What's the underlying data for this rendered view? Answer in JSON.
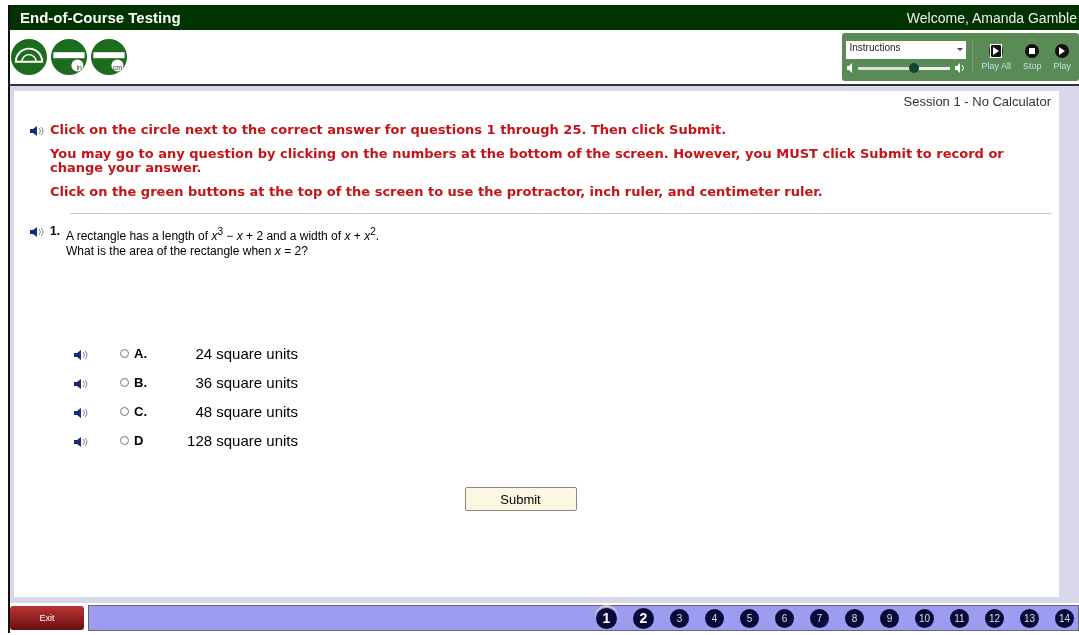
{
  "header": {
    "title": "End-of-Course Testing",
    "welcome": "Welcome, Amanda Gamble"
  },
  "tools": [
    {
      "kind": "protractor"
    },
    {
      "kind": "ruler",
      "unit": "in"
    },
    {
      "kind": "ruler",
      "unit": "cm"
    }
  ],
  "audio": {
    "dropdown": "Instructions",
    "level": 0.6,
    "buttons": [
      {
        "kind": "play-all",
        "label": "Play All"
      },
      {
        "kind": "stop",
        "label": "Stop"
      },
      {
        "kind": "play",
        "label": "Play"
      }
    ]
  },
  "session": "Session 1 - No Calculator",
  "instructions": [
    "Click on the circle next to the correct answer for questions 1 through 25. Then click Submit.",
    "You may go to any question by clicking on the numbers at the bottom of the screen. However, you MUST click Submit to record or change your answer.",
    "Click on the green buttons at the top of the screen to use the protractor, inch ruler, and centimeter ruler."
  ],
  "question": {
    "number": "1.",
    "lines": [
      "A rectangle has a length of *x*$^{3}$ − *x* + 2 and a width of *x* + *x*$^{2}$.",
      "What is the area of the rectangle when *x* = 2?"
    ]
  },
  "choices": [
    {
      "letter": "A.",
      "text": "24 square units",
      "selected": false
    },
    {
      "letter": "B.",
      "text": "36 square units",
      "selected": false
    },
    {
      "letter": "C.",
      "text": "48 square units",
      "selected": false
    },
    {
      "letter": "D",
      "text": "128 square units",
      "selected": false
    }
  ],
  "submit": "Submit",
  "exit": "Exit",
  "questions": [
    {
      "label": "1",
      "selected": true,
      "visited": true
    },
    {
      "label": "2",
      "selected": false,
      "visited": true
    },
    {
      "label": "3",
      "selected": false,
      "visited": false
    },
    {
      "label": "4",
      "selected": false,
      "visited": false
    },
    {
      "label": "5",
      "selected": false,
      "visited": false
    },
    {
      "label": "6",
      "selected": false,
      "visited": false
    },
    {
      "label": "7",
      "selected": false,
      "visited": false
    },
    {
      "label": "8",
      "selected": false,
      "visited": false
    },
    {
      "label": "9",
      "selected": false,
      "visited": false
    },
    {
      "label": "10",
      "selected": false,
      "visited": false
    },
    {
      "label": "11",
      "selected": false,
      "visited": false
    },
    {
      "label": "12",
      "selected": false,
      "visited": false
    },
    {
      "label": "13",
      "selected": false,
      "visited": false
    },
    {
      "label": "14",
      "selected": false,
      "visited": false
    }
  ]
}
